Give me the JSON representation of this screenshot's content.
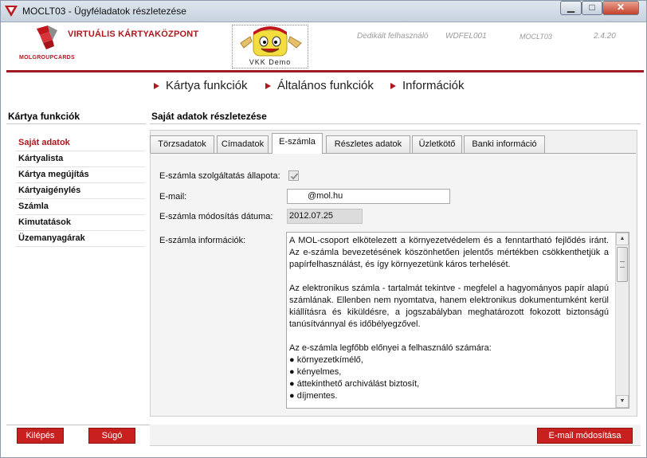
{
  "window": {
    "title": "MOCLT03 - Ügyféladatok részletezése",
    "min_label": "▁",
    "max_label": "□",
    "close_label": "✕"
  },
  "header": {
    "brand": "VIRTUÁLIS KÁRTYAKÖZPONT",
    "brand_sub": "MOLGROUPCARDS",
    "mascot_label": "VKK Demo",
    "user_label": "Dedikált felhasználó",
    "user_id": "WDFEL001",
    "screen_code": "MOCLT03",
    "version": "2.4.20"
  },
  "topnav": [
    "Kártya funkciók",
    "Általános funkciók",
    "Információk"
  ],
  "sidebar": {
    "title": "Kártya funkciók",
    "items": [
      {
        "label": "Saját adatok",
        "active": true
      },
      {
        "label": "Kártyalista"
      },
      {
        "label": "Kártya megújítás"
      },
      {
        "label": "Kártyaigénylés"
      },
      {
        "label": "Számla"
      },
      {
        "label": "Kimutatások"
      },
      {
        "label": "Üzemanyagárak"
      }
    ]
  },
  "main": {
    "title": "Saját adatok részletezése",
    "tabs": [
      "Törzsadatok",
      "Címadatok",
      "E-számla",
      "Részletes adatok",
      "Üzletkötő",
      "Banki információ"
    ],
    "active_tab": "E-számla",
    "form": {
      "status_label": "E-számla szolgáltatás állapota:",
      "status_checked": true,
      "email_label": "E-mail:",
      "email_value": "@mol.hu",
      "modified_label": "E-számla módosítás dátuma:",
      "modified_value": "2012.07.25",
      "info_label": "E-számla információk:",
      "info_paragraphs": [
        "A MOL-csoport elkötelezett a környezetvédelem és a fenntartható fejlődés iránt. Az e-számla bevezetésének köszönhetően jelentős mértékben csökkenthetjük a papírfelhasználást, és így környezetünk káros terhelését.",
        "Az elektronikus számla - tartalmát tekintve - megfelel a hagyományos papír alapú számlának. Ellenben nem nyomtatva, hanem elektronikus dokumentumként kerül kiállításra és kiküldésre, a jogszabályban meghatározott fokozott biztonságú tanúsítvánnyal és időbélyegzővel."
      ],
      "info_list_intro": "Az e-számla legfőbb előnyei a felhasználó számára:",
      "info_list": [
        "környezetkímélő,",
        "kényelmes,",
        "áttekinthető archiválást biztosít,",
        "díjmentes."
      ]
    }
  },
  "footer": {
    "exit_label": "Kilépés",
    "help_label": "Súgó",
    "email_modify_label": "E-mail módosítása"
  },
  "colors": {
    "brand_red": "#b0171f",
    "button_red": "#c8201f"
  }
}
